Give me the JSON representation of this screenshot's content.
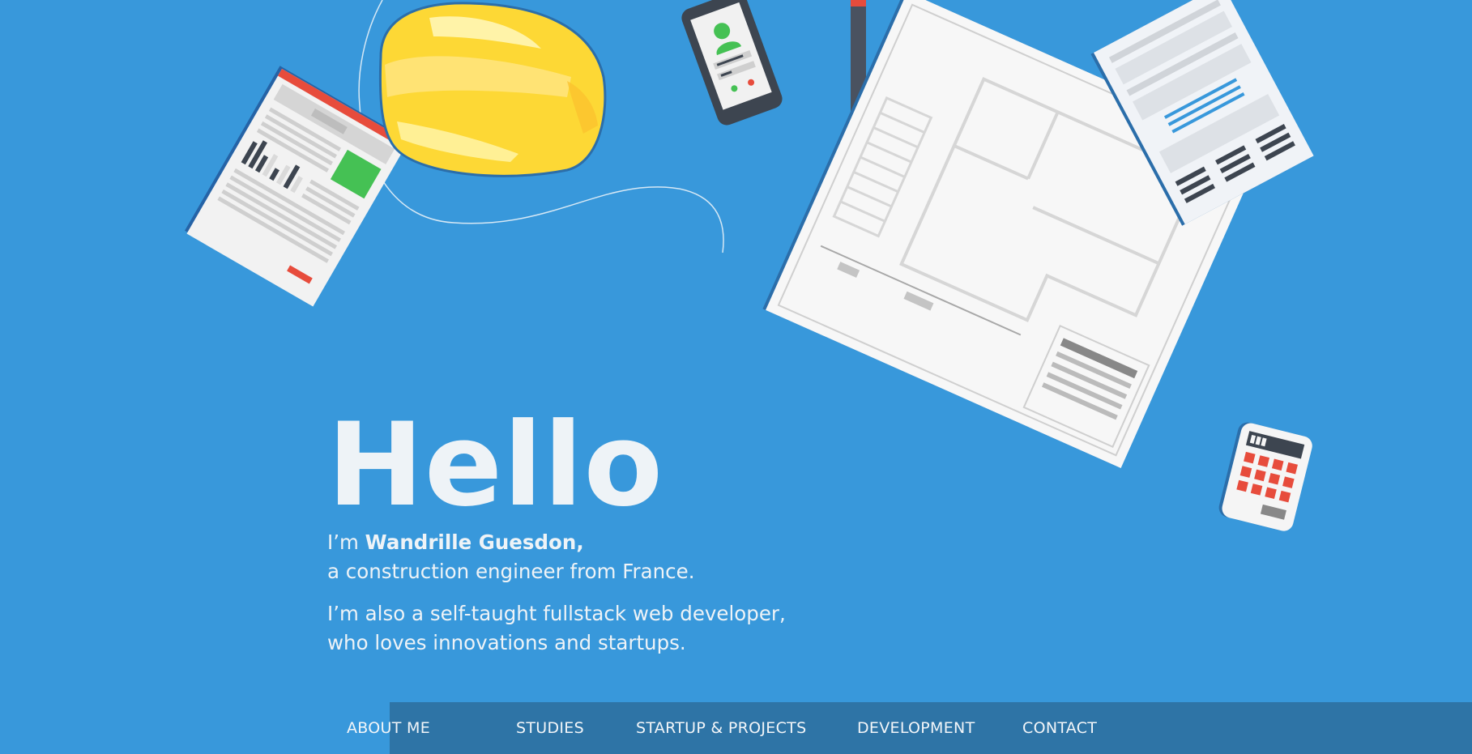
{
  "hero": {
    "title": "Hello",
    "intro_prefix": "I’m ",
    "name": "Wandrille Guesdon,",
    "line2": "a construction engineer from France.",
    "line3": "I’m also a self-taught fullstack web developer,",
    "line4": "who loves innovations and startups."
  },
  "nav": {
    "items": [
      {
        "label": "ABOUT ME"
      },
      {
        "label": "STUDIES"
      },
      {
        "label": "STARTUP & PROJECTS"
      },
      {
        "label": "DEVELOPMENT"
      },
      {
        "label": "CONTACT"
      }
    ]
  },
  "colors": {
    "background": "#3898db",
    "navbar": "#2e74a6",
    "text": "#eef3f7",
    "helmet": "#fdd835",
    "accent_red": "#e74c3c",
    "accent_green": "#45c154",
    "dark": "#3d4550"
  },
  "illustrations": [
    "report-document-icon",
    "hard-hat-icon",
    "smartphone-icon",
    "pencil-icon",
    "blueprint-icon",
    "form-document-icon",
    "calculator-icon"
  ]
}
